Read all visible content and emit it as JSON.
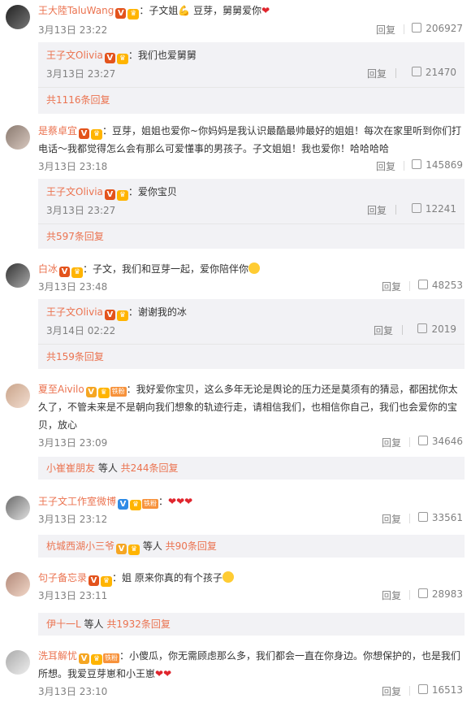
{
  "comments": [
    {
      "name": "王大陸TaluWang",
      "text": "：子文姐💪 豆芽，舅舅爱你",
      "time": "3月13日 23:22",
      "reply": "回复",
      "likes": "206927",
      "sub": {
        "name": "王子文Olivia",
        "text": "：我们也爱舅舅",
        "time": "3月13日 23:27",
        "reply": "回复",
        "likes": "21470",
        "more": "共1116条回复"
      }
    },
    {
      "name": "是蔡卓宜",
      "text": "：豆芽，姐姐也爱你~你妈妈是我认识最酷最帅最好的姐姐！每次在家里听到你们打电话～我都觉得怎么会有那么可爱懂事的男孩子。子文姐姐！我也爱你！哈哈哈哈",
      "time": "3月13日 23:18",
      "reply": "回复",
      "likes": "145869",
      "sub": {
        "name": "王子文Olivia",
        "text": "：爱你宝贝",
        "time": "3月13日 23:27",
        "reply": "回复",
        "likes": "12241",
        "more": "共597条回复"
      }
    },
    {
      "name": "白冰",
      "text": "：子文，我们和豆芽一起，爱你陪伴你",
      "time": "3月13日 23:48",
      "reply": "回复",
      "likes": "48253",
      "sub": {
        "name": "王子文Olivia",
        "text": "：谢谢我的冰",
        "time": "3月14日 02:22",
        "reply": "回复",
        "likes": "2019",
        "more": "共159条回复"
      }
    },
    {
      "name": "夏至Aivilo",
      "fan": "铁粉",
      "text": "：我好爱你宝贝，这么多年无论是舆论的压力还是莫须有的猜忌，都困扰你太久了，不管未来是不是朝向我们想象的轨迹行走，请相信我们，也相信你自己，我们也会爱你的宝贝，放心",
      "time": "3月13日 23:09",
      "reply": "回复",
      "likes": "34646",
      "more_user": "小崔崔朋友",
      "more_tail": " 等人 ",
      "more": "共244条回复"
    },
    {
      "name": "王子文工作室微博",
      "fan": "铁粉",
      "text": "：",
      "time": "3月13日 23:12",
      "reply": "回复",
      "likes": "33561",
      "more_user": "杭城西湖小三爷",
      "more_tail": " 等人 ",
      "more": "共90条回复"
    },
    {
      "name": "句子备忘录",
      "text": "：姐 原来你真的有个孩子",
      "time": "3月13日 23:11",
      "reply": "回复",
      "likes": "28983",
      "more_user": "伊十一L",
      "more_tail": " 等人 ",
      "more": "共1932条回复"
    },
    {
      "name": "洗耳解忧",
      "fan": "铁粉",
      "text": "：小傻瓜，你无需顾虑那么多，我们都会一直在你身边。你想保护的，也是我们所想。我爱豆芽崽和小王崽",
      "time": "3月13日 23:10",
      "reply": "回复",
      "likes": "16513"
    }
  ],
  "colors": {
    "name": "#eb7350",
    "meta": "#808080",
    "subbox": "#f2f2f5"
  },
  "icons": {
    "like": "thumbs-up-icon",
    "verified": "verified-v-icon",
    "crown": "member-crown-icon"
  }
}
